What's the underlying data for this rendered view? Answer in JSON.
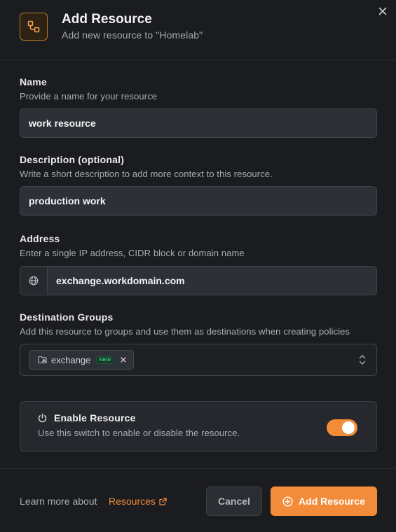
{
  "header": {
    "title": "Add Resource",
    "subtitle": "Add new resource to \"Homelab\"",
    "icon": "resource-icon"
  },
  "fields": {
    "name": {
      "label": "Name",
      "help": "Provide a name for your resource",
      "value": "work resource"
    },
    "description": {
      "label": "Description (optional)",
      "help": "Write a short description to add more context to this resource.",
      "value": "production work"
    },
    "address": {
      "label": "Address",
      "help": "Enter a single IP address, CIDR block or domain name",
      "value": "exchange.workdomain.com",
      "icon": "globe-icon"
    },
    "groups": {
      "label": "Destination Groups",
      "help": "Add this resource to groups and use them as destinations when creating policies",
      "chips": [
        {
          "label": "exchange",
          "badge": "NEW"
        }
      ]
    }
  },
  "enable": {
    "title": "Enable Resource",
    "description": "Use this switch to enable or disable the resource.",
    "enabled": true
  },
  "footer": {
    "learn_text": "Learn more about",
    "learn_link": "Resources",
    "cancel_label": "Cancel",
    "add_label": "Add Resource"
  },
  "colors": {
    "accent": "#f28c3b",
    "background": "#1b1c20",
    "badge_green": "#3ec07a"
  }
}
